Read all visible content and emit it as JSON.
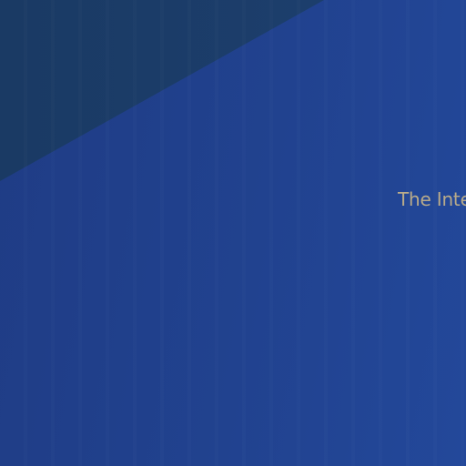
{
  "hero": {
    "text": "The Inte",
    "text_color": "#b9ab8a"
  },
  "colors": {
    "background": "#21428f",
    "corner_panel": "#1b3c69"
  }
}
